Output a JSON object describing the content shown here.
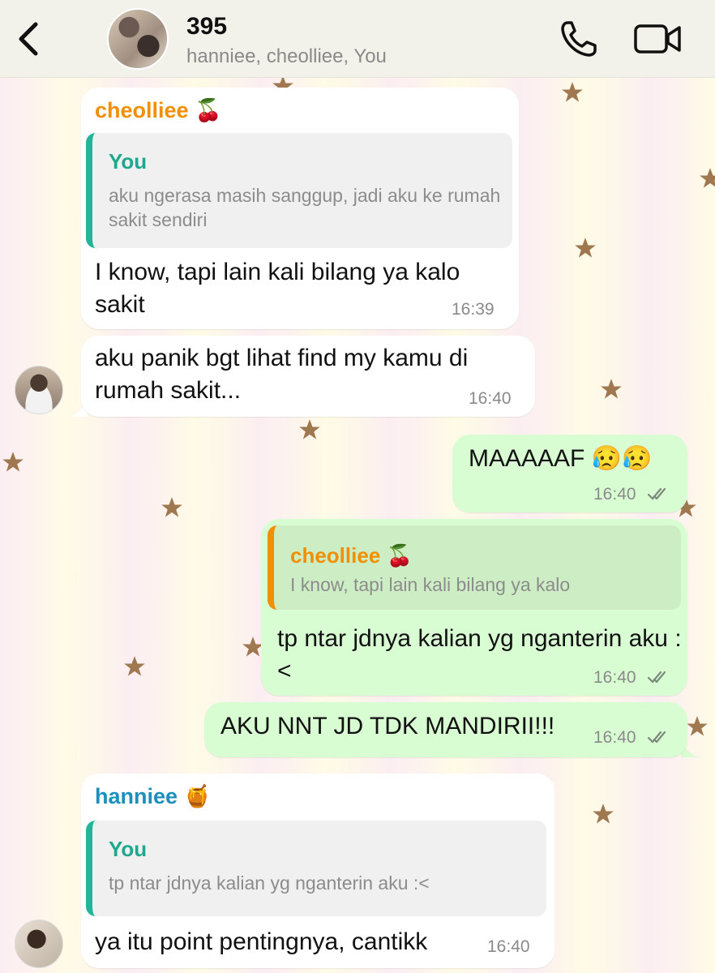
{
  "header": {
    "title": "395",
    "members": "hanniee, cheolliee, You"
  },
  "colors": {
    "header_bg": "#f3f2ea",
    "incoming_bubble": "#ffffff",
    "outgoing_bubble": "#d9fdd3",
    "sender_orange": "#f08f00",
    "sender_blue": "#1d8fbd",
    "quote_green": "#1fa88e",
    "star": "#a07850"
  },
  "icons": [
    "back-chevron-icon",
    "group-avatar",
    "phone-icon",
    "video-call-icon",
    "double-check-icon",
    "star-icon"
  ],
  "messages": [
    {
      "sender": "cheolliee 🍒",
      "quote_name": "You",
      "quote_text": "aku ngerasa masih sanggup, jadi aku ke rumah sakit sendiri",
      "text": "I know, tapi lain kali bilang ya kalo sakit",
      "time": "16:39"
    },
    {
      "text": "aku panik bgt lihat find my kamu di rumah sakit...",
      "time": "16:40"
    },
    {
      "text": "MAAAAAF 😥😥",
      "time": "16:40"
    },
    {
      "quote_name": "cheolliee 🍒",
      "quote_text": "I know, tapi lain kali bilang ya kalo",
      "text": "tp ntar jdnya kalian yg nganterin aku :<",
      "time": "16:40"
    },
    {
      "text": "AKU NNT JD TDK MANDIRII!!!",
      "time": "16:40"
    },
    {
      "sender": "hanniee 🍯",
      "quote_name": "You",
      "quote_text": "tp ntar jdnya kalian yg nganterin aku :<",
      "text": "ya itu point pentingnya, cantikk",
      "time": "16:40"
    }
  ]
}
